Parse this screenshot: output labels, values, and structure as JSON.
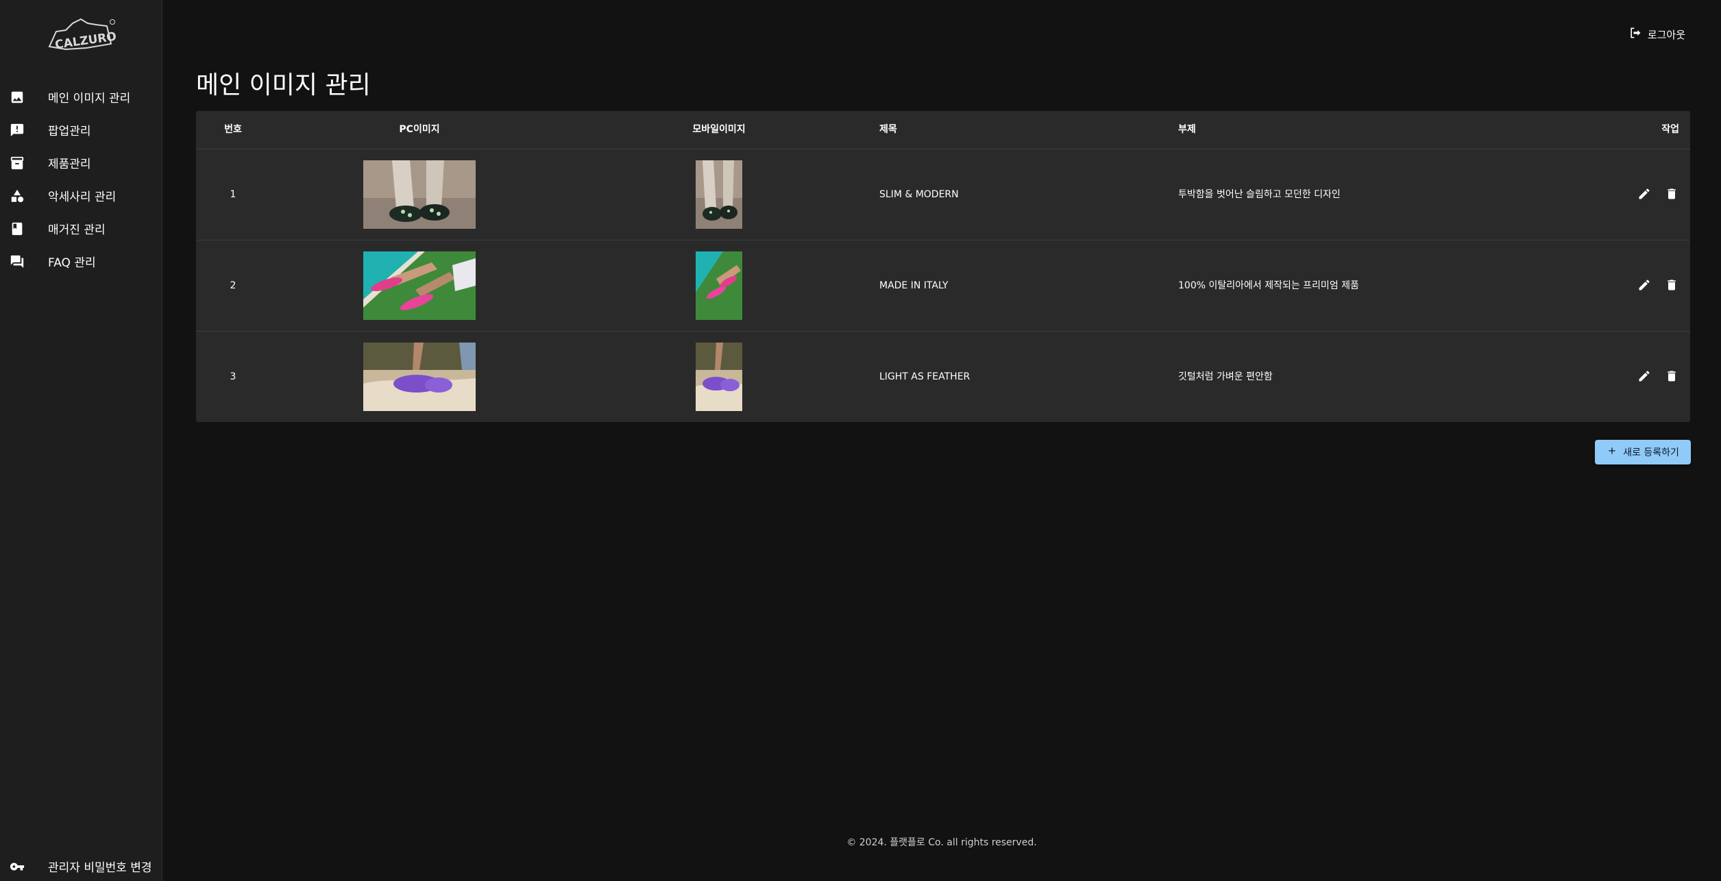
{
  "brand": {
    "logo_text": "CALZURO"
  },
  "sidebar": {
    "items": [
      {
        "label": "메인 이미지 관리",
        "icon": "image-icon"
      },
      {
        "label": "팝업관리",
        "icon": "announcement-icon"
      },
      {
        "label": "제품관리",
        "icon": "archive-icon"
      },
      {
        "label": "악세사리 관리",
        "icon": "category-shapes-icon"
      },
      {
        "label": "매거진 관리",
        "icon": "book-icon"
      },
      {
        "label": "FAQ 관리",
        "icon": "forum-icon"
      }
    ],
    "bottom": {
      "label": "관리자 비밀번호 변경",
      "icon": "key-icon"
    }
  },
  "header": {
    "logout_label": "로그아웃"
  },
  "page": {
    "title": "메인 이미지 관리"
  },
  "table": {
    "columns": {
      "number": "번호",
      "pc_image": "PC이미지",
      "mobile_image": "모바일이미지",
      "title": "제목",
      "subtitle": "부제",
      "actions": "작업"
    },
    "rows": [
      {
        "number": "1",
        "title": "SLIM & MODERN",
        "subtitle": "투박함을 벗어난 슬림하고 모던한 디자인"
      },
      {
        "number": "2",
        "title": "MADE IN ITALY",
        "subtitle": "100% 이탈리아에서 제작되는 프리미엄 제품"
      },
      {
        "number": "3",
        "title": "LIGHT AS FEATHER",
        "subtitle": "깃털처럼 가벼운 편안함"
      }
    ]
  },
  "actions": {
    "add_label": "새로 등록하기"
  },
  "footer": {
    "copyright": "© 2024. 플랫플로 Co. all rights reserved."
  },
  "colors": {
    "background": "#121212",
    "sidebar": "#1e1e1e",
    "table": "#2a2a2a",
    "accent": "#90caf9"
  }
}
